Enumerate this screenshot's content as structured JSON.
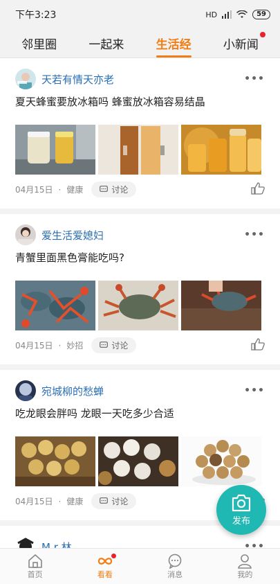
{
  "status": {
    "time": "下午3:23",
    "network": "HD",
    "battery": "59"
  },
  "tabs": [
    {
      "label": "邻里圈"
    },
    {
      "label": "一起来"
    },
    {
      "label": "生活经",
      "active": true
    },
    {
      "label": "小新闻",
      "badge": true
    }
  ],
  "posts": [
    {
      "author": "天若有情天亦老",
      "title": "夏天蜂蜜要放冰箱吗 蜂蜜放冰箱容易结晶",
      "date": "04月15日",
      "category": "健康",
      "discuss": "讨论",
      "more": "•••"
    },
    {
      "author": "爱生活爱媳妇",
      "title": "青蟹里面黑色膏能吃吗?",
      "date": "04月15日",
      "category": "妙招",
      "discuss": "讨论",
      "more": "•••"
    },
    {
      "author": "宛城柳的愁蝉",
      "title": "吃龙眼会胖吗 龙眼一天吃多少合适",
      "date": "04月15日",
      "category": "健康",
      "discuss": "讨论",
      "more": "•••"
    },
    {
      "author": "M r 林",
      "more": "•••"
    }
  ],
  "fab": {
    "label": "发布"
  },
  "bottom_nav": [
    {
      "label": "首页",
      "icon": "home-icon"
    },
    {
      "label": "看看",
      "icon": "infinity-icon",
      "active": true,
      "badge": true
    },
    {
      "label": "消息",
      "icon": "chat-icon"
    },
    {
      "label": "我的",
      "icon": "user-icon"
    }
  ],
  "colors": {
    "accent": "#f07d14",
    "author": "#2a6fb5",
    "fab": "#1fb8b3",
    "badge": "#e8232b"
  }
}
